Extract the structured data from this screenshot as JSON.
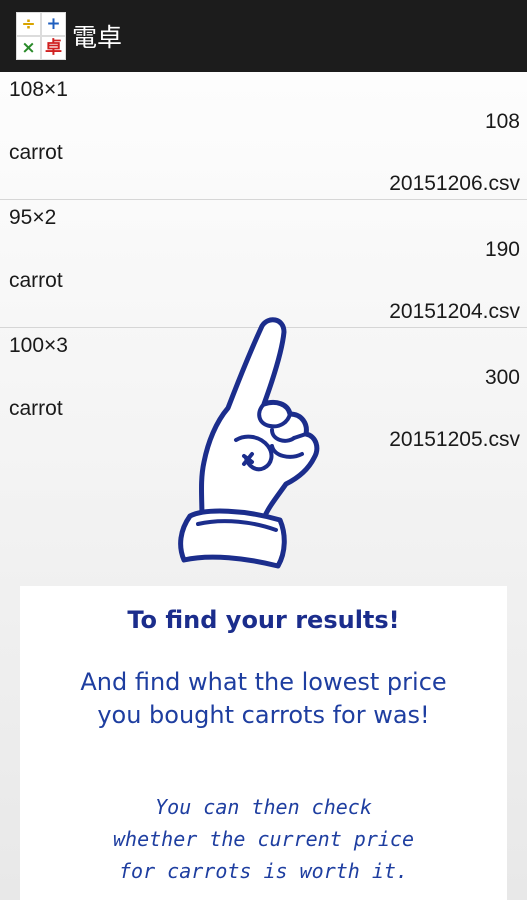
{
  "app": {
    "title": "電卓",
    "icon_glyphs": [
      "÷",
      "+",
      "×",
      "卓"
    ],
    "icon_colors": [
      "#d8a400",
      "#1f5fbf",
      "#2a8a2a",
      "#d02020"
    ]
  },
  "records": [
    {
      "expression": "108×1",
      "total": "108",
      "item": "carrot",
      "file": "20151206.csv"
    },
    {
      "expression": "95×2",
      "total": "190",
      "item": "carrot",
      "file": "20151204.csv"
    },
    {
      "expression": "100×3",
      "total": "300",
      "item": "carrot",
      "file": "20151205.csv"
    }
  ],
  "tutorial": {
    "heading": "To find your results!",
    "body_lines": [
      "And find what the lowest price",
      "you bought carrots for was!"
    ],
    "note_lines": [
      "You can then check",
      "whether the current price",
      "for carrots is worth it."
    ]
  },
  "colors": {
    "action_bar": "#1c1c1c",
    "heading": "#1b2d8c",
    "body_text": "#1e3ea0"
  }
}
